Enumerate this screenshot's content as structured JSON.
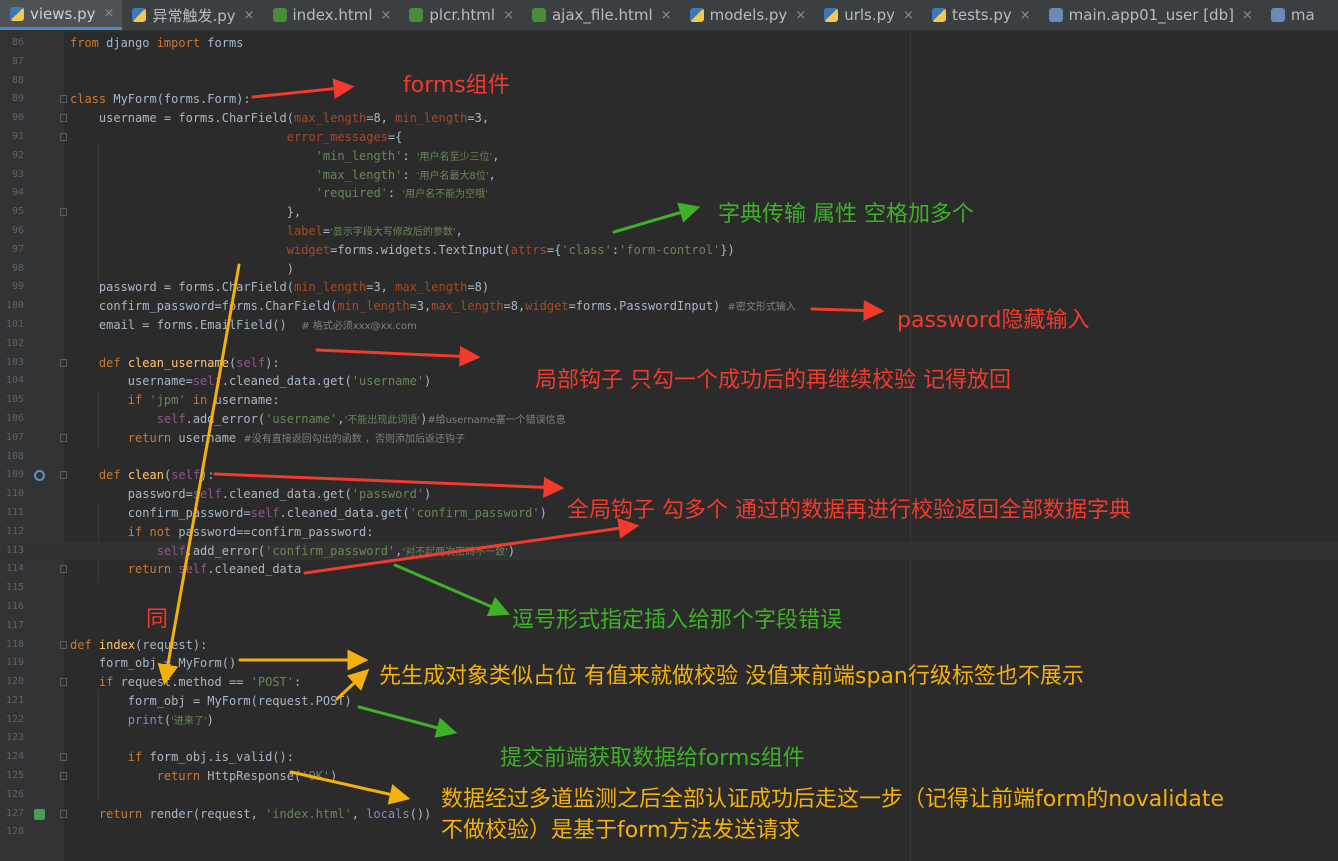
{
  "tabs": [
    {
      "label": "views.py",
      "icon": "python-file-icon",
      "type": "py",
      "active": true
    },
    {
      "label": "异常触发.py",
      "icon": "python-file-icon",
      "type": "py"
    },
    {
      "label": "index.html",
      "icon": "html-file-icon",
      "type": "html"
    },
    {
      "label": "plcr.html",
      "icon": "html-file-icon",
      "type": "html"
    },
    {
      "label": "ajax_file.html",
      "icon": "html-file-icon",
      "type": "html"
    },
    {
      "label": "models.py",
      "icon": "python-file-icon",
      "type": "py"
    },
    {
      "label": "urls.py",
      "icon": "python-file-icon",
      "type": "py"
    },
    {
      "label": "tests.py",
      "icon": "python-file-icon",
      "type": "py"
    },
    {
      "label": "main.app01_user [db]",
      "icon": "database-table-icon",
      "type": "db"
    },
    {
      "label": "ma",
      "icon": "database-table-icon",
      "type": "db"
    }
  ],
  "editor": {
    "current_line": 113,
    "lines": [
      {
        "n": 86,
        "s": [
          [
            "from",
            "#cc7832"
          ],
          [
            " django "
          ],
          [
            "import",
            "#cc7832"
          ],
          [
            " forms"
          ]
        ]
      },
      {
        "n": 87,
        "s": []
      },
      {
        "n": 88,
        "s": []
      },
      {
        "n": 89,
        "fold": true,
        "s": [
          [
            "class",
            "#cc7832"
          ],
          [
            " MyForm(forms.Form):"
          ]
        ]
      },
      {
        "n": 90,
        "fold": true,
        "s": [
          [
            "    username = forms.CharField("
          ],
          [
            "max_length",
            "#aa4926"
          ],
          [
            "=8, "
          ],
          [
            "min_length",
            "#aa4926"
          ],
          [
            "=3,"
          ]
        ]
      },
      {
        "n": 91,
        "fold": true,
        "s": [
          [
            "                              "
          ],
          [
            "error_messages",
            "#aa4926"
          ],
          [
            "={"
          ]
        ]
      },
      {
        "n": 92,
        "s": [
          [
            "                                  "
          ],
          [
            "'min_length'",
            "#6a8759"
          ],
          [
            ": "
          ],
          [
            "'用户名至少三位'",
            "#6a8759",
            "cn"
          ],
          [
            ","
          ]
        ]
      },
      {
        "n": 93,
        "s": [
          [
            "                                  "
          ],
          [
            "'max_length'",
            "#6a8759"
          ],
          [
            ": "
          ],
          [
            "'用户名最大8位'",
            "#6a8759",
            "cn"
          ],
          [
            ","
          ]
        ]
      },
      {
        "n": 94,
        "s": [
          [
            "                                  "
          ],
          [
            "'required'",
            "#6a8759"
          ],
          [
            ": "
          ],
          [
            "'用户名不能为空哦'",
            "#6a8759",
            "cn"
          ]
        ]
      },
      {
        "n": 95,
        "fold": true,
        "s": [
          [
            "                              },"
          ]
        ]
      },
      {
        "n": 96,
        "s": [
          [
            "                              "
          ],
          [
            "label",
            "#aa4926"
          ],
          [
            "="
          ],
          [
            "'显示字段大写修改后的参数'",
            "#6a8759",
            "cn"
          ],
          [
            ","
          ]
        ]
      },
      {
        "n": 97,
        "s": [
          [
            "                              "
          ],
          [
            "widget",
            "#aa4926"
          ],
          [
            "=forms.widgets.TextInput("
          ],
          [
            "attrs",
            "#aa4926"
          ],
          [
            "={"
          ],
          [
            "'class'",
            "#6a8759"
          ],
          [
            ":"
          ],
          [
            "'form-control'",
            "#6a8759"
          ],
          [
            "})"
          ]
        ]
      },
      {
        "n": 98,
        "s": [
          [
            "                              )"
          ]
        ]
      },
      {
        "n": 99,
        "s": [
          [
            "    password = forms.CharField("
          ],
          [
            "min_length",
            "#aa4926"
          ],
          [
            "=3, "
          ],
          [
            "max_length",
            "#aa4926"
          ],
          [
            "=8)"
          ]
        ]
      },
      {
        "n": 100,
        "s": [
          [
            "    confirm_password=forms.CharField("
          ],
          [
            "min_length",
            "#aa4926"
          ],
          [
            "=3,"
          ],
          [
            "max_length",
            "#aa4926"
          ],
          [
            "=8,"
          ],
          [
            "widget",
            "#aa4926"
          ],
          [
            "=forms.PasswordInput) "
          ],
          [
            "#密文形式输入",
            "#808080",
            "cn"
          ]
        ]
      },
      {
        "n": 101,
        "s": [
          [
            "    email = forms.EmailField()  "
          ],
          [
            "# 格式必须xxx@xx.com",
            "#808080",
            "cn"
          ]
        ]
      },
      {
        "n": 102,
        "s": []
      },
      {
        "n": 103,
        "fold": true,
        "s": [
          [
            "    "
          ],
          [
            "def",
            "#cc7832"
          ],
          [
            " "
          ],
          [
            "clean_username",
            "#ffc66d"
          ],
          [
            "("
          ],
          [
            "self",
            "#94558d"
          ],
          [
            "):"
          ]
        ]
      },
      {
        "n": 104,
        "s": [
          [
            "        username="
          ],
          [
            "self",
            "#94558d"
          ],
          [
            ".cleaned_data.get("
          ],
          [
            "'username'",
            "#6a8759"
          ],
          [
            ")"
          ]
        ]
      },
      {
        "n": 105,
        "s": [
          [
            "        "
          ],
          [
            "if",
            "#cc7832"
          ],
          [
            " "
          ],
          [
            "'jpm'",
            "#6a8759"
          ],
          [
            " "
          ],
          [
            "in",
            "#cc7832"
          ],
          [
            " username:"
          ]
        ]
      },
      {
        "n": 106,
        "s": [
          [
            "            "
          ],
          [
            "self",
            "#94558d"
          ],
          [
            ".add_error("
          ],
          [
            "'username'",
            "#6a8759"
          ],
          [
            ","
          ],
          [
            "'不能出现此词语'",
            "#6a8759",
            "cn"
          ],
          [
            ")"
          ],
          [
            "#给username塞一个错误信息",
            "#808080",
            "cn"
          ]
        ]
      },
      {
        "n": 107,
        "fold": true,
        "s": [
          [
            "        "
          ],
          [
            "return",
            "#cc7832"
          ],
          [
            " username "
          ],
          [
            "#没有直接返回勾出的函数 ，否则添加后返还钩子",
            "#808080",
            "cn"
          ]
        ]
      },
      {
        "n": 108,
        "s": []
      },
      {
        "n": 109,
        "fold": true,
        "gico": "override",
        "s": [
          [
            "    "
          ],
          [
            "def",
            "#cc7832"
          ],
          [
            " "
          ],
          [
            "clean",
            "#ffc66d"
          ],
          [
            "("
          ],
          [
            "self",
            "#94558d"
          ],
          [
            "):"
          ]
        ]
      },
      {
        "n": 110,
        "s": [
          [
            "        password="
          ],
          [
            "self",
            "#94558d"
          ],
          [
            ".cleaned_data.get("
          ],
          [
            "'password'",
            "#6a8759"
          ],
          [
            ")"
          ]
        ]
      },
      {
        "n": 111,
        "s": [
          [
            "        confirm_password="
          ],
          [
            "self",
            "#94558d"
          ],
          [
            ".cleaned_data.get("
          ],
          [
            "'confirm_password'",
            "#6a8759"
          ],
          [
            ")"
          ]
        ]
      },
      {
        "n": 112,
        "s": [
          [
            "        "
          ],
          [
            "if not",
            "#cc7832"
          ],
          [
            " password==confirm_password:"
          ]
        ]
      },
      {
        "n": 113,
        "s": [
          [
            "            "
          ],
          [
            "self",
            "#94558d"
          ],
          [
            ".add_error("
          ],
          [
            "'confirm_password'",
            "#6a8759"
          ],
          [
            ","
          ],
          [
            "'对不起两次密码不一致'",
            "#6a8759",
            "cn"
          ],
          [
            ")"
          ]
        ]
      },
      {
        "n": 114,
        "fold": true,
        "s": [
          [
            "        "
          ],
          [
            "return",
            "#cc7832"
          ],
          [
            " "
          ],
          [
            "self",
            "#94558d"
          ],
          [
            ".cleaned_data"
          ]
        ]
      },
      {
        "n": 115,
        "s": []
      },
      {
        "n": 116,
        "s": []
      },
      {
        "n": 117,
        "s": []
      },
      {
        "n": 118,
        "fold": true,
        "s": [
          [
            "def",
            "#cc7832"
          ],
          [
            " "
          ],
          [
            "index",
            "#ffc66d"
          ],
          [
            "(request):"
          ]
        ]
      },
      {
        "n": 119,
        "s": [
          [
            "    form_obj = MyForm()"
          ]
        ]
      },
      {
        "n": 120,
        "fold": true,
        "s": [
          [
            "    "
          ],
          [
            "if",
            "#cc7832"
          ],
          [
            " request.method == "
          ],
          [
            "'POST'",
            "#6a8759"
          ],
          [
            ":"
          ]
        ]
      },
      {
        "n": 121,
        "s": [
          [
            "        form_obj = MyForm(request.POST)"
          ]
        ]
      },
      {
        "n": 122,
        "s": [
          [
            "        "
          ],
          [
            "print",
            "#8888c6"
          ],
          [
            "("
          ],
          [
            "'进来了'",
            "#6a8759",
            "cn"
          ],
          [
            ")"
          ]
        ]
      },
      {
        "n": 123,
        "s": []
      },
      {
        "n": 124,
        "fold": true,
        "s": [
          [
            "        "
          ],
          [
            "if",
            "#cc7832"
          ],
          [
            " form_obj.is_valid():"
          ]
        ]
      },
      {
        "n": 125,
        "fold": true,
        "s": [
          [
            "            "
          ],
          [
            "return",
            "#cc7832"
          ],
          [
            " HttpResponse("
          ],
          [
            "'OK'",
            "#6a8759"
          ],
          [
            ")"
          ]
        ]
      },
      {
        "n": 126,
        "s": []
      },
      {
        "n": 127,
        "fold": true,
        "gico": "run",
        "s": [
          [
            "    "
          ],
          [
            "return",
            "#cc7832"
          ],
          [
            " render(request, "
          ],
          [
            "'index.html'",
            "#6a8759"
          ],
          [
            ", "
          ],
          [
            "locals",
            "#8888c6"
          ],
          [
            "())"
          ]
        ]
      },
      {
        "n": 128,
        "s": []
      }
    ]
  },
  "annotations": {
    "forms_component": "forms组件",
    "dict_attrs": "字典传输 属性 空格加多个",
    "password_hidden": "password隐藏输入",
    "local_hook": "局部钩子 只勾一个成功后的再继续校验 记得放回",
    "global_hook": "全局钩子 勾多个 通过的数据再进行校验返回全部数据字典",
    "comma_field_error": "逗号形式指定插入给那个字段错误",
    "same": "同",
    "create_obj": "先生成对象类似占位 有值来就做校验 没值来前端span行级标签也不展示",
    "submit_forms": "提交前端获取数据给forms组件",
    "validated_line1": "数据经过多道监测之后全部认证成功后走这一步（记得让前端form的novalidate",
    "validated_line2": "不做校验）是基于form方法发送请求"
  },
  "colors": {
    "red": "#f23a2d",
    "green": "#3fb128",
    "orange": "#f4b10b"
  }
}
